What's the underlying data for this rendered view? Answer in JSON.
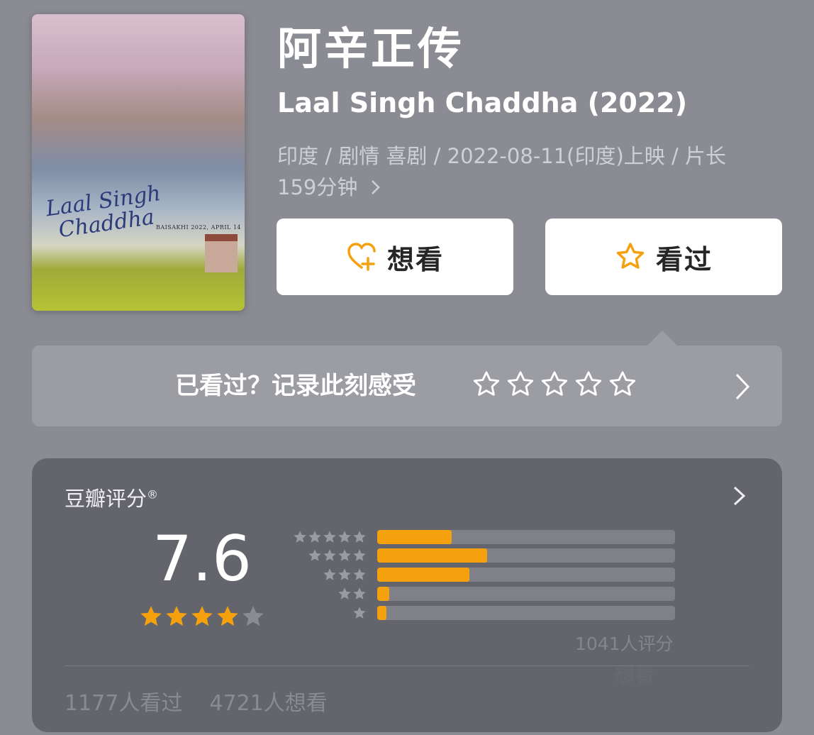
{
  "poster": {
    "title": "Laal Singh Chaddha",
    "date": "BAISAKHI 2022, APRIL 14"
  },
  "title_cn": "阿辛正传",
  "title_en": "Laal Singh Chaddha (2022)",
  "meta_line1": "印度 / 剧情 喜剧 / 2022-08-11(印度)上映 / 片长",
  "meta_line2": "159分钟",
  "buttons": {
    "want": {
      "label": "想看",
      "icon": "heart-plus-icon"
    },
    "seen": {
      "label": "看过",
      "icon": "star-outline-icon"
    }
  },
  "record": {
    "text": "已看过？记录此刻感受",
    "stars_icon": "star-outline-icon"
  },
  "rating": {
    "label": "豆瓣评分",
    "registered_mark": "®",
    "score": "7.6",
    "score_stars": 3.8,
    "distribution": [
      {
        "stars": 5,
        "percent": 25
      },
      {
        "stars": 4,
        "percent": 37
      },
      {
        "stars": 3,
        "percent": 31
      },
      {
        "stars": 2,
        "percent": 4
      },
      {
        "stars": 1,
        "percent": 2
      }
    ],
    "raters": "1041人评分",
    "ghost_text": "想看",
    "seen_count": "1177人看过",
    "want_count": "4721人想看"
  },
  "colors": {
    "background": "#8b8c93",
    "accent": "#f5a10d",
    "card": "#63646c"
  }
}
